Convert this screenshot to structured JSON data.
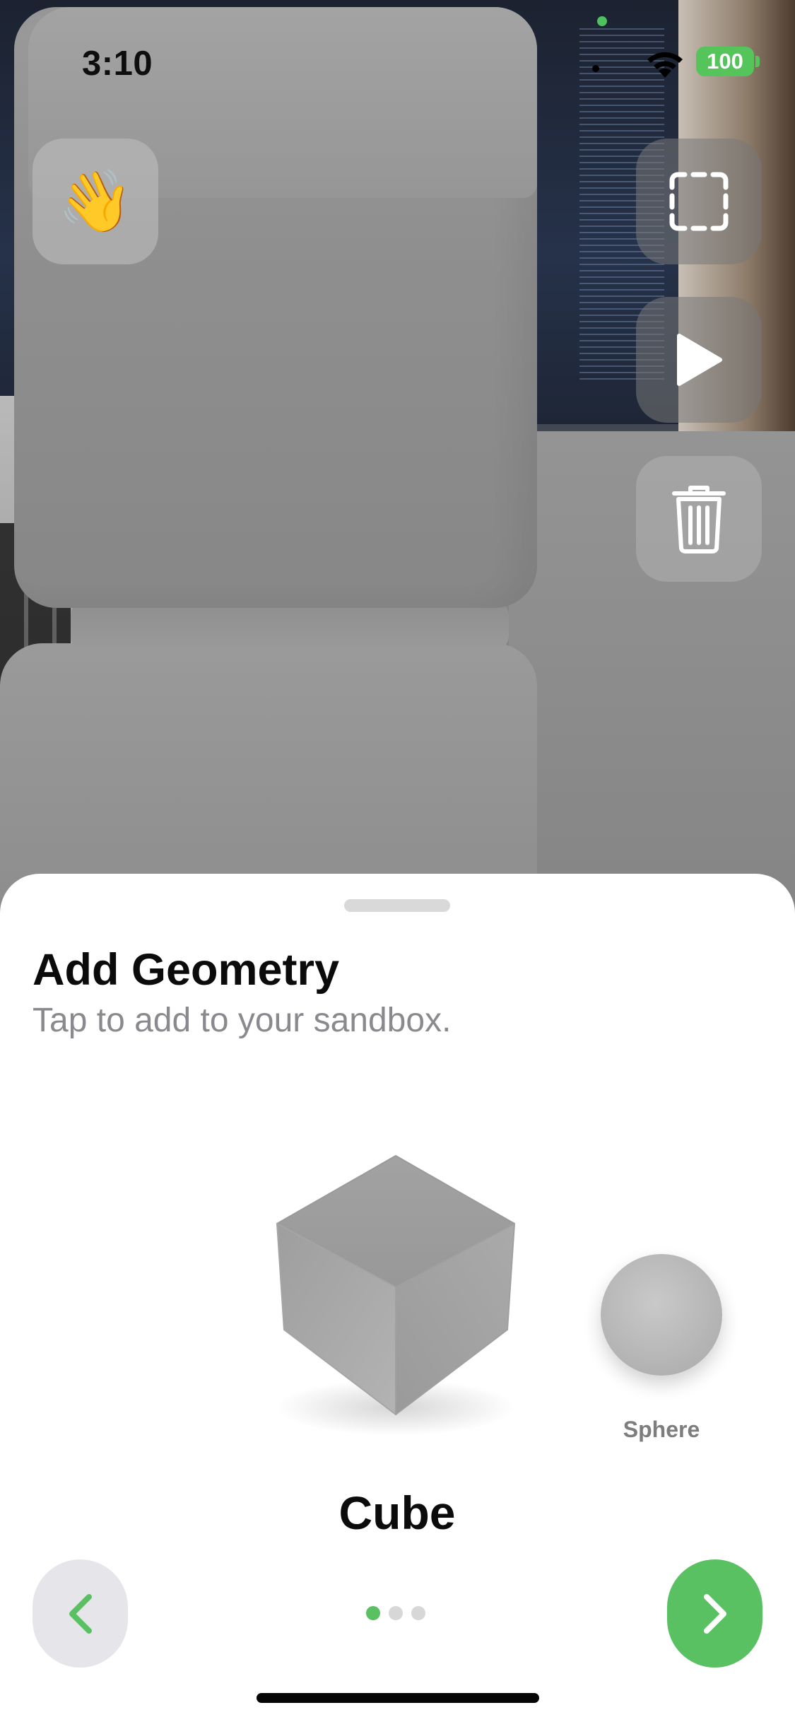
{
  "status_bar": {
    "time": "3:10",
    "battery": "100"
  },
  "buttons": {
    "wave": {
      "emoji": "👋",
      "icon": "waving-hand-icon"
    },
    "select": {
      "icon": "dashed-selection-icon"
    },
    "play": {
      "icon": "play-icon"
    },
    "trash": {
      "icon": "trash-icon"
    }
  },
  "sheet": {
    "title": "Add Geometry",
    "subtitle": "Tap to add to your sandbox.",
    "items": [
      {
        "label": "Cube",
        "selected": true
      },
      {
        "label": "Sphere",
        "selected": false
      }
    ],
    "page_dots": {
      "count": 3,
      "active_index": 0
    }
  },
  "colors": {
    "accent": "#5ac162",
    "battery": "#54c45b",
    "prev_button_bg": "#e5e5ea",
    "subtitle_text": "#8a8a8e"
  }
}
